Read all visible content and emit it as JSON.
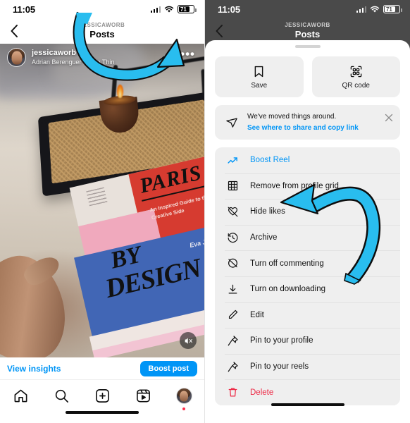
{
  "status_bar": {
    "time": "11:05",
    "battery_level": "71",
    "icons": [
      "cellular-signal-icon",
      "wifi-icon",
      "battery-icon"
    ]
  },
  "nav": {
    "back_icon": "back-chevron-icon",
    "subtitle": "JESSICAWORB",
    "title": "Posts"
  },
  "left_panel": {
    "post": {
      "username": "jessicaworb",
      "audio": "Adrian Berenguer · Little Thin",
      "more_icon": "more-options-icon",
      "mute_icon": "mute-icon",
      "avatar": "profile-avatar"
    },
    "insights_link": "View insights",
    "boost_button": "Boost post",
    "tab_bar": [
      {
        "name": "home-icon"
      },
      {
        "name": "search-icon"
      },
      {
        "name": "create-icon"
      },
      {
        "name": "reels-icon"
      },
      {
        "name": "profile-avatar-icon"
      }
    ]
  },
  "right_panel": {
    "quick_actions": [
      {
        "icon": "bookmark-icon",
        "label": "Save"
      },
      {
        "icon": "qr-code-icon",
        "label": "QR code"
      }
    ],
    "notice": {
      "icon": "share-paper-plane-icon",
      "title": "We've moved things around.",
      "link": "See where to share and copy link",
      "close_icon": "close-icon"
    },
    "menu_items": [
      {
        "icon": "trending-up-icon",
        "label": "Boost Reel",
        "style": "accent"
      },
      {
        "icon": "grid-icon",
        "label": "Remove from profile grid",
        "style": "normal"
      },
      {
        "icon": "hide-likes-icon",
        "label": "Hide likes",
        "style": "normal"
      },
      {
        "icon": "archive-clock-icon",
        "label": "Archive",
        "style": "normal"
      },
      {
        "icon": "comment-off-icon",
        "label": "Turn off commenting",
        "style": "normal"
      },
      {
        "icon": "download-icon",
        "label": "Turn on downloading",
        "style": "normal"
      },
      {
        "icon": "edit-pencil-icon",
        "label": "Edit",
        "style": "normal"
      },
      {
        "icon": "pin-icon",
        "label": "Pin to your profile",
        "style": "normal"
      },
      {
        "icon": "pin-icon",
        "label": "Pin to your reels",
        "style": "normal"
      },
      {
        "icon": "trash-icon",
        "label": "Delete",
        "style": "danger"
      }
    ]
  },
  "annotations": [
    {
      "name": "arrow-to-more-options",
      "color": "#29BDEF"
    },
    {
      "name": "arrow-to-hide-likes",
      "color": "#29BDEF"
    }
  ],
  "media_text": {
    "book_title": "PARIS",
    "book_subtitle": "An Inspired Guide to the City's Creative Side",
    "book_word_by": "BY",
    "book_word_design": "DESIGN",
    "book_author": "Eva Jorgensen"
  },
  "colors": {
    "accent_blue": "#0095f6",
    "danger_red": "#ed2a46",
    "sheet_cell": "#efefef",
    "annotation": "#29BDEF"
  }
}
